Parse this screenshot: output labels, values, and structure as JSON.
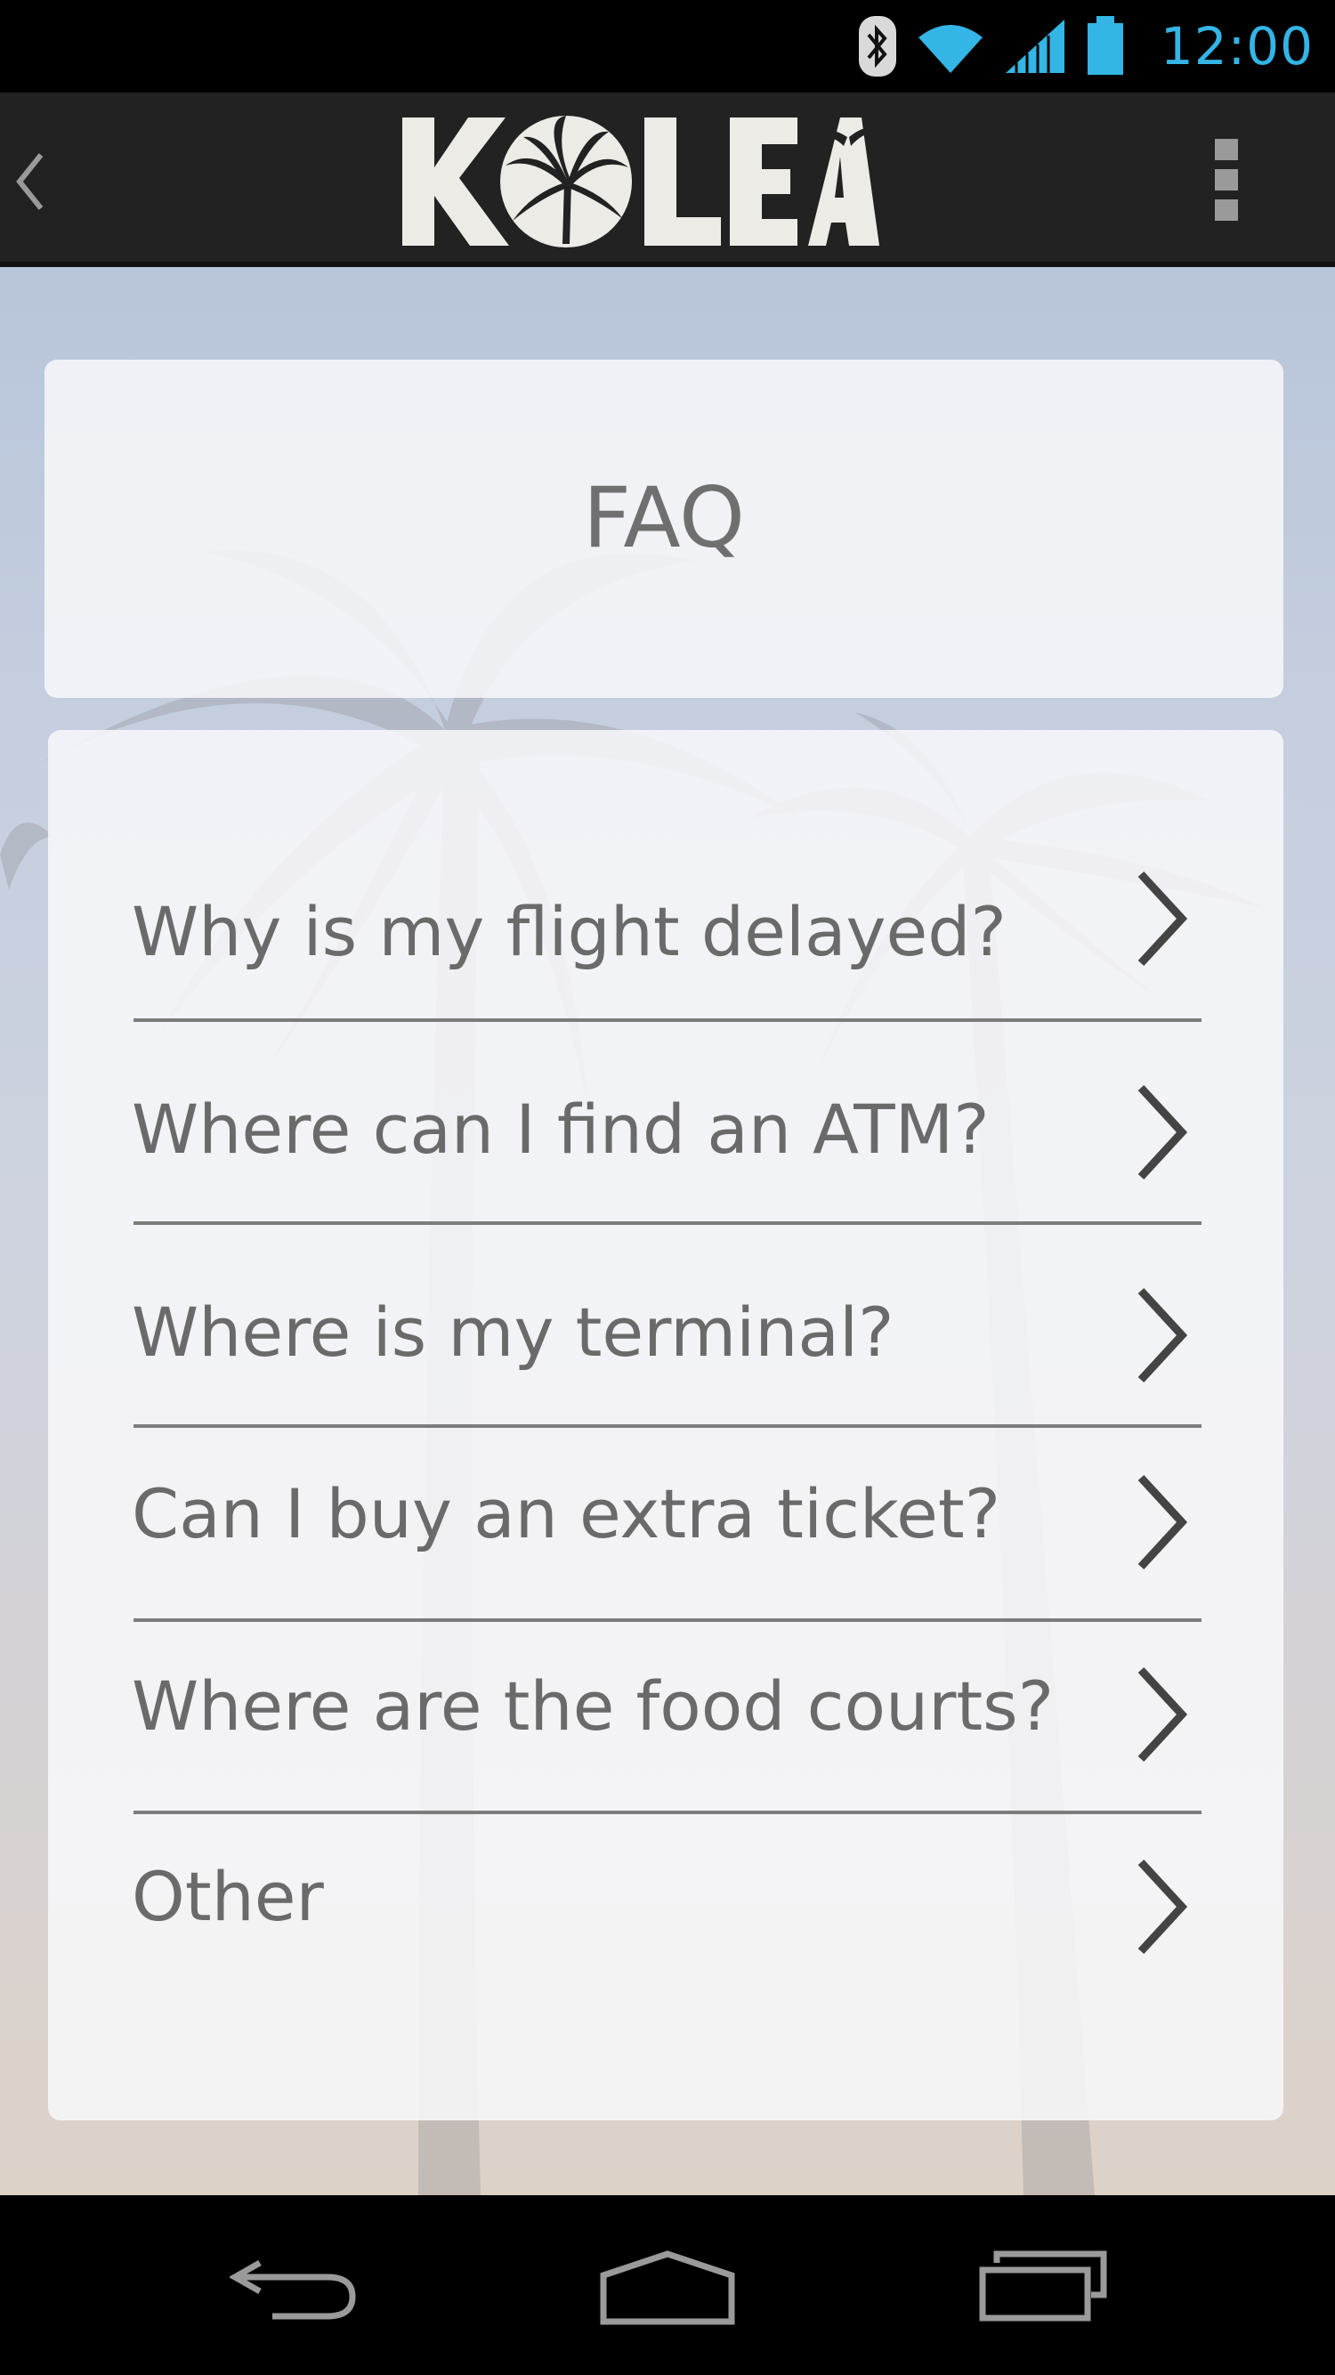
{
  "status_bar": {
    "time": "12:00",
    "icons": [
      "bluetooth-icon",
      "wifi-icon",
      "cell-signal-icon",
      "battery-icon"
    ],
    "accent_color": "#33b5e5"
  },
  "action_bar": {
    "logo_text": "KOLEA",
    "back_icon": "chevron-left-icon",
    "menu_icon": "overflow-menu-icon"
  },
  "page": {
    "title": "FAQ"
  },
  "faq": {
    "items": [
      {
        "label": "Why is my flight delayed?"
      },
      {
        "label": "Where can I find an ATM?"
      },
      {
        "label": "Where is my terminal?"
      },
      {
        "label": "Can I buy an extra ticket?"
      },
      {
        "label": "Where are the food courts?"
      },
      {
        "label": "Other"
      }
    ]
  },
  "nav_bar": {
    "icons": [
      "back-nav-icon",
      "home-nav-icon",
      "recent-apps-icon"
    ]
  }
}
